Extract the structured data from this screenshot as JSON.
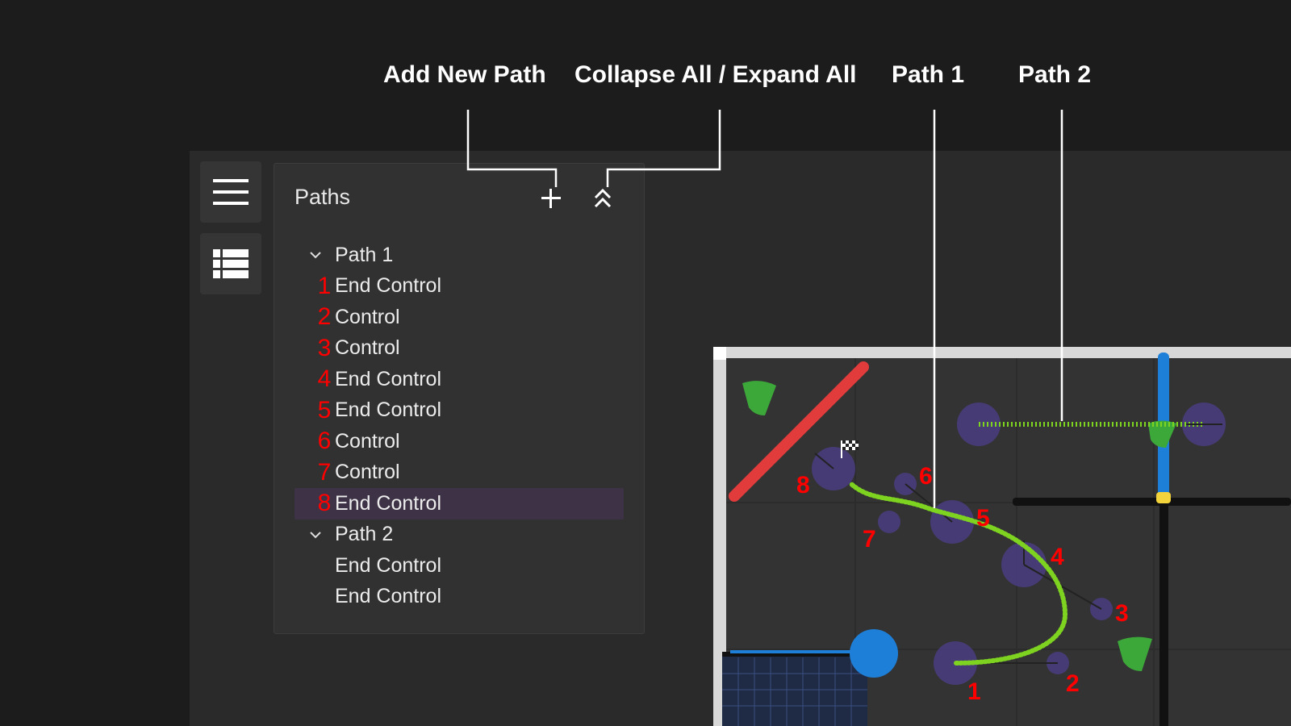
{
  "callouts": {
    "add_new_path": "Add New Path",
    "collapse_expand": "Collapse All / Expand All",
    "path1": "Path 1",
    "path2": "Path 2"
  },
  "panel": {
    "title": "Paths",
    "add_icon": "plus-icon",
    "collapse_icon": "double-chevron-up-icon"
  },
  "sidebar": {
    "menu_icon": "hamburger-menu-icon",
    "list_icon": "list-view-icon"
  },
  "tree": {
    "path1": {
      "label": "Path 1",
      "nodes": [
        {
          "num": "1",
          "label": "End Control"
        },
        {
          "num": "2",
          "label": "Control"
        },
        {
          "num": "3",
          "label": "Control"
        },
        {
          "num": "4",
          "label": "End Control"
        },
        {
          "num": "5",
          "label": "End Control"
        },
        {
          "num": "6",
          "label": "Control"
        },
        {
          "num": "7",
          "label": "Control"
        },
        {
          "num": "8",
          "label": "End Control",
          "selected": true
        }
      ]
    },
    "path2": {
      "label": "Path 2",
      "nodes": [
        {
          "label": "End Control"
        },
        {
          "label": "End Control"
        }
      ]
    }
  },
  "field": {
    "markers": [
      "1",
      "2",
      "3",
      "4",
      "5",
      "6",
      "7",
      "8"
    ]
  },
  "colors": {
    "background": "#1c1c1c",
    "panel": "#313131",
    "selected_row": "#3e3346",
    "marker_red": "#ff0000",
    "path_green": "#7ed321",
    "control_purple": "#4a3d80"
  }
}
